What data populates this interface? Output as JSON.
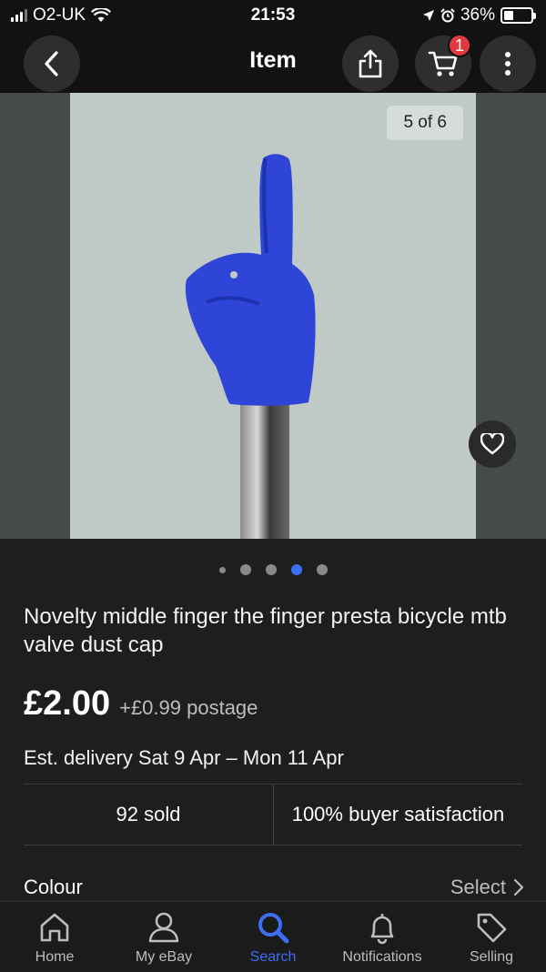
{
  "status_bar": {
    "carrier": "O2-UK",
    "time": "21:53",
    "battery": "36%"
  },
  "nav": {
    "title": "Item",
    "cart_count": "1"
  },
  "gallery": {
    "counter": "5 of 6",
    "current_index": 4,
    "total": 6
  },
  "item": {
    "title": "Novelty middle finger the finger presta bicycle mtb valve dust cap",
    "price": "£2.00",
    "postage": "+£0.99 postage",
    "delivery": "Est. delivery Sat 9 Apr – Mon 11 Apr",
    "sold": "92 sold",
    "satisfaction": "100% buyer satisfaction",
    "colour_label": "Colour",
    "colour_action": "Select"
  },
  "tabs": [
    {
      "label": "Home",
      "icon": "home-icon"
    },
    {
      "label": "My eBay",
      "icon": "person-icon"
    },
    {
      "label": "Search",
      "icon": "search-icon"
    },
    {
      "label": "Notifications",
      "icon": "bell-icon"
    },
    {
      "label": "Selling",
      "icon": "tag-icon"
    }
  ],
  "colors": {
    "accent": "#3d6ff5",
    "badge": "#e0393e",
    "background": "#1e1e1e"
  }
}
